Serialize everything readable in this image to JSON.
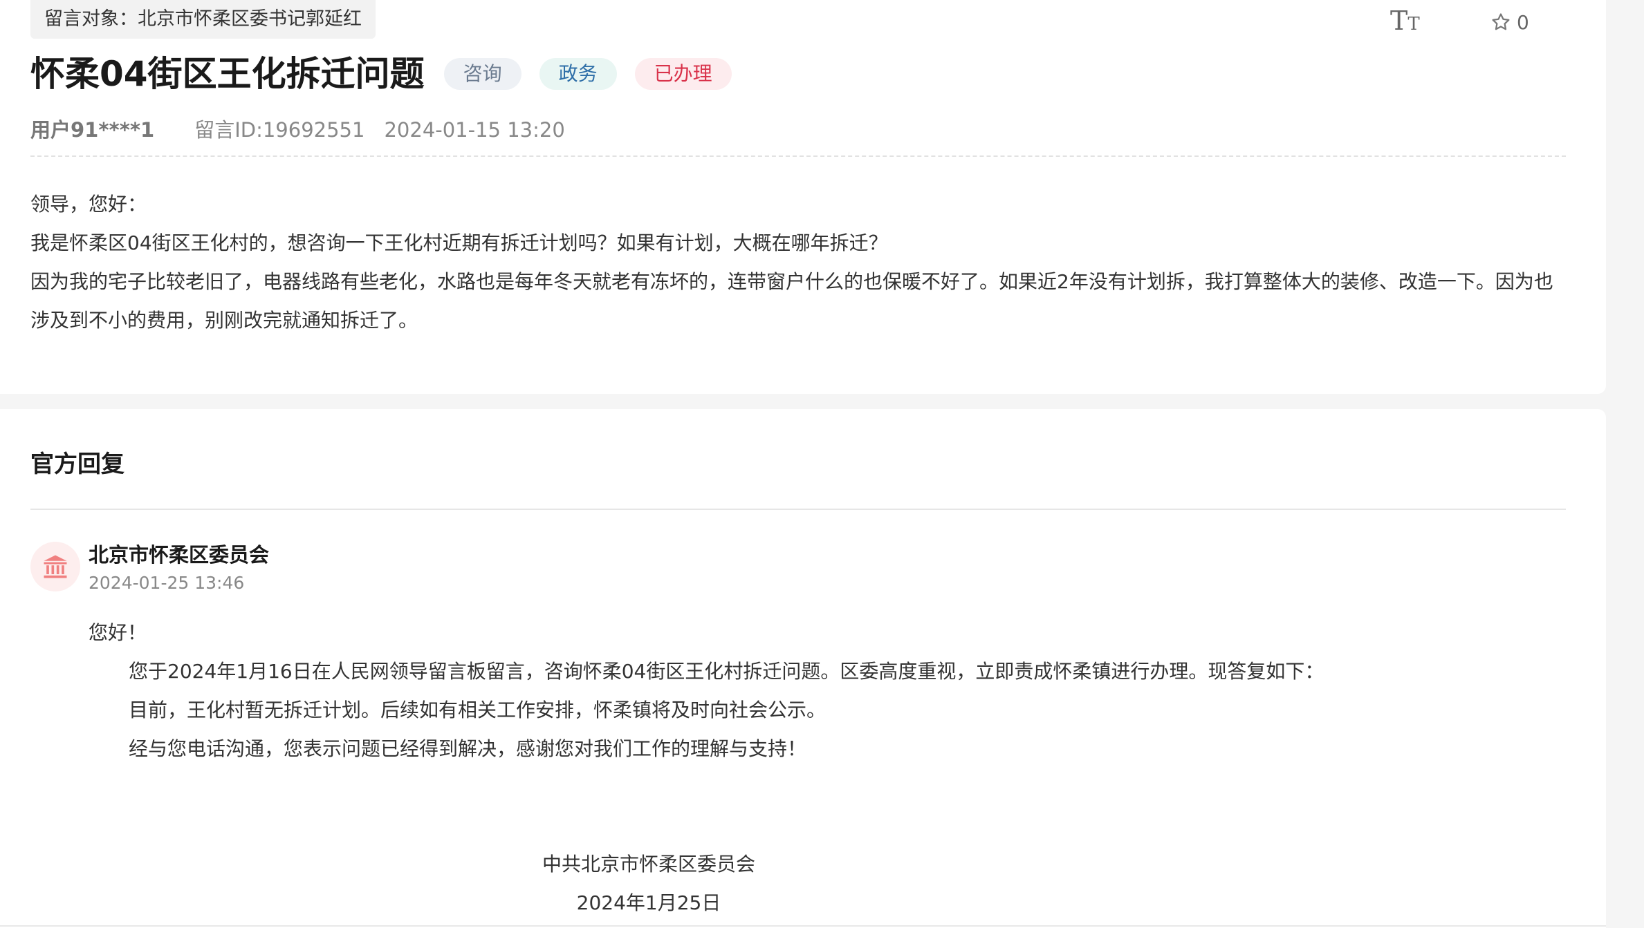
{
  "message": {
    "target": "留言对象：北京市怀柔区委书记郭延红",
    "title": "怀柔04街区王化拆迁问题",
    "tags": [
      "咨询",
      "政务",
      "已办理"
    ],
    "user": "用户91****1",
    "message_id": "留言ID:19692551",
    "time": "2024-01-15 13:20",
    "star_count": "0",
    "body": [
      "领导，您好：",
      "我是怀柔区04街区王化村的，想咨询一下王化村近期有拆迁计划吗？如果有计划，大概在哪年拆迁？",
      "因为我的宅子比较老旧了，电器线路有些老化，水路也是每年冬天就老有冻坏的，连带窗户什么的也保暖不好了。如果近2年没有计划拆，我打算整体大的装修、改造一下。因为也涉及到不小的费用，别刚改完就通知拆迁了。"
    ]
  },
  "reply": {
    "heading": "官方回复",
    "org": "北京市怀柔区委员会",
    "time": "2024-01-25 13:46",
    "greeting": "您好！",
    "paragraphs": [
      "您于2024年1月16日在人民网领导留言板留言，咨询怀柔04街区王化村拆迁问题。区委高度重视，立即责成怀柔镇进行办理。现答复如下：",
      "目前，王化村暂无拆迁计划。后续如有相关工作安排，怀柔镇将及时向社会公示。",
      "经与您电话沟通，您表示问题已经得到解决，感谢您对我们工作的理解与支持！"
    ],
    "sign_org": "中共北京市怀柔区委员会",
    "sign_date": "2024年1月25日"
  },
  "icons": {
    "font_size": "font-size-icon",
    "star": "star-outline-icon",
    "avatar": "government-building-icon"
  },
  "colors": {
    "tag_consult": "#6b7b8f",
    "tag_gov": "#2f6fa8",
    "tag_done": "#d9324a",
    "avatar_bg": "#fdeeee",
    "avatar_fg": "#f08080"
  }
}
